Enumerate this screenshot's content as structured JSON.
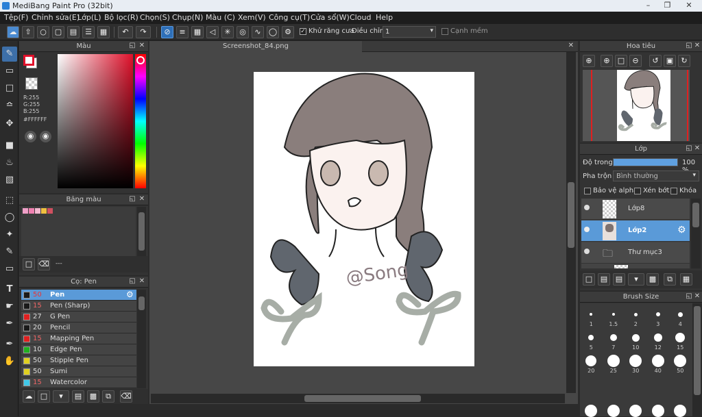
{
  "app": {
    "title": "MediBang Paint Pro (32bit)"
  },
  "menu": [
    "Tệp(F)",
    "Chỉnh sửa(E)",
    "Lớp(L)",
    "Bộ lọc(R)",
    "Chọn(S)",
    "Chụp(N)",
    "Màu (C)",
    "Xem(V)",
    "Công cụ(T)",
    "Cửa sổ(W)",
    "Cloud",
    "Help"
  ],
  "toolbar": {
    "antialias_label": "Khử răng cưa",
    "adjust_label": "Điều chỉnh",
    "adjust_value": "1",
    "soft_edge_label": "Cạnh mềm"
  },
  "color_panel": {
    "title": "Màu",
    "r": "R:255",
    "g": "G:255",
    "b": "B:255",
    "hex": "#FFFFFF",
    "accent": "#e0102a"
  },
  "palette_panel": {
    "title": "Bảng màu",
    "swatches": [
      "#f0a0c8",
      "#f080b0",
      "#f4b8d0",
      "#f0c040",
      "#d05060"
    ],
    "footer": "---"
  },
  "brush_list_panel": {
    "title": "Cọ: Pen",
    "brushes": [
      {
        "size": "50",
        "name": "Pen",
        "color": "#1a1a1a"
      },
      {
        "size": "15",
        "name": "Pen (Sharp)",
        "color": "#1a1a1a"
      },
      {
        "size": "27",
        "name": "G Pen",
        "color": "#e02020"
      },
      {
        "size": "20",
        "name": "Pencil",
        "color": "#1a1a1a"
      },
      {
        "size": "15",
        "name": "Mapping Pen",
        "color": "#e02020"
      },
      {
        "size": "10",
        "name": "Edge Pen",
        "color": "#20b020"
      },
      {
        "size": "50",
        "name": "Stipple Pen",
        "color": "#e0d020"
      },
      {
        "size": "50",
        "name": "Sumi",
        "color": "#e0d020"
      },
      {
        "size": "15",
        "name": "Watercolor",
        "color": "#40c8e8"
      }
    ]
  },
  "document": {
    "tab_title": "Screenshot_84.png",
    "watermark": "@Song"
  },
  "navigator": {
    "title": "Hoa tiêu"
  },
  "layer_panel": {
    "title": "Lớp",
    "opacity_label": "Độ trong",
    "opacity_value": "100 %",
    "opacity_fraction": 1.0,
    "blend_label": "Pha trộn",
    "blend_value": "Bình thường",
    "protect_alpha": "Bảo vệ alpha",
    "clipping": "Xén bớt",
    "lock": "Khóa",
    "layers": [
      {
        "name": "Lớp8",
        "selected": false
      },
      {
        "name": "Lớp2",
        "selected": true
      },
      {
        "name": "Thư mục3",
        "selected": false
      }
    ]
  },
  "brush_size_panel": {
    "title": "Brush Size",
    "sizes": [
      "1",
      "1.5",
      "2",
      "3",
      "4",
      "5",
      "7",
      "10",
      "12",
      "15",
      "20",
      "25",
      "30",
      "40",
      "50"
    ]
  }
}
